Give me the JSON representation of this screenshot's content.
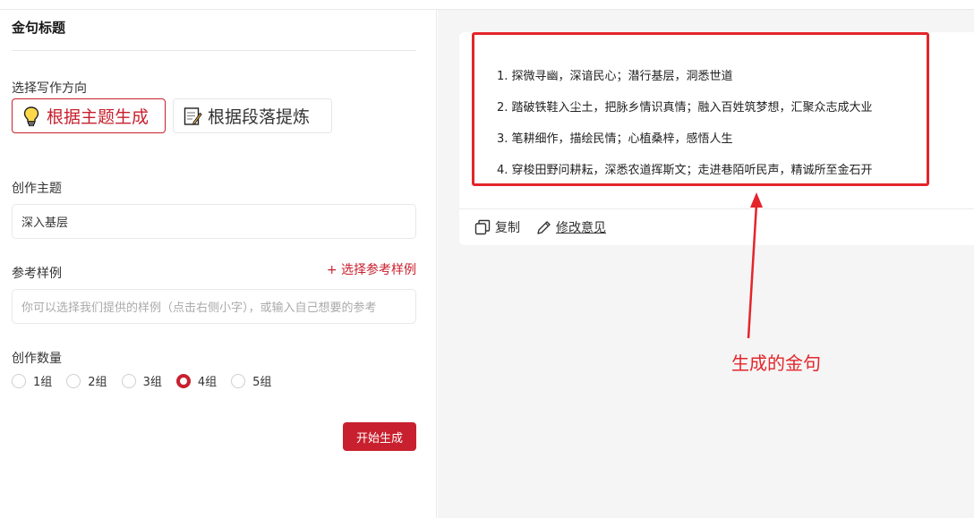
{
  "form": {
    "title": "金句标题",
    "direction_label": "选择写作方向",
    "direction_options": [
      {
        "label": "根据主题生成",
        "icon": "lightbulb-icon",
        "active": true
      },
      {
        "label": "根据段落提炼",
        "icon": "memo-icon",
        "active": false
      }
    ],
    "theme_label": "创作主题",
    "theme_value": "深入基层",
    "reference_label": "参考样例",
    "reference_link": "+ 选择参考样例",
    "reference_placeholder": "你可以选择我们提供的样例（点击右侧小字），或输入自己想要的参考",
    "count_label": "创作数量",
    "count_options": [
      "1组",
      "2组",
      "3组",
      "4组",
      "5组"
    ],
    "count_selected": "4组",
    "start_button": "开始生成"
  },
  "result": {
    "sentences": [
      "1. 探微寻幽，深谙民心；潜行基层，洞悉世道",
      "2. 踏破铁鞋入尘土，把脉乡情识真情；融入百姓筑梦想，汇聚众志成大业",
      "3. 笔耕细作，描绘民情；心植桑梓，感悟人生",
      "4. 穿梭田野问耕耘，深悉农道挥斯文；走进巷陌听民声，精诚所至金石开"
    ],
    "copy_label": "复制",
    "feedback_label": "修改意见"
  },
  "annotation": {
    "text": "生成的金句",
    "color": "#e4252b"
  },
  "colors": {
    "accent": "#c8202e",
    "highlight": "#e4252b"
  }
}
